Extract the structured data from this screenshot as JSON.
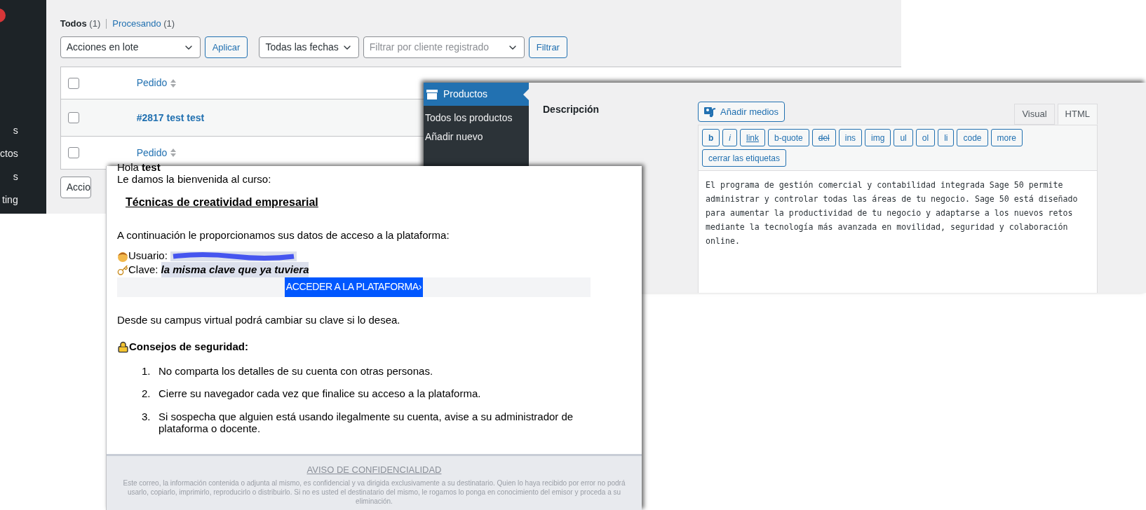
{
  "orders_screen": {
    "sidebar_fragments": [
      "s",
      "ctos",
      "s",
      "ting"
    ],
    "views": [
      {
        "label": "Todos",
        "count": "(1)",
        "selected": true
      },
      {
        "label": "Procesando",
        "count": "(1)",
        "selected": false
      }
    ],
    "bulk_action": "Acciones en lote",
    "apply": "Aplicar",
    "date_filter": "Todas las fechas",
    "customer_filter": {
      "placeholder": "Filtrar por cliente registrado"
    },
    "filter": "Filtrar",
    "columns": [
      "Pedido"
    ],
    "header_checked": false,
    "rows": [
      {
        "order": "#2817 test test",
        "checked": false
      }
    ],
    "footer_column": "Pedido",
    "footer_checked": false,
    "bottom_bulk_action": "Accio"
  },
  "product_screen": {
    "menu": {
      "title": "Productos",
      "items": [
        "Todos los productos",
        "Añadir nuevo"
      ]
    },
    "field_label": "Descripción",
    "add_media": "Añadir medios",
    "editor_tabs": [
      {
        "label": "Visual",
        "selected": false
      },
      {
        "label": "HTML",
        "selected": true
      }
    ],
    "toolbar": [
      {
        "label": "b",
        "kind": "bold"
      },
      {
        "label": "i",
        "kind": "italic"
      },
      {
        "label": "link",
        "kind": "underline"
      },
      {
        "label": "b-quote",
        "kind": "plain"
      },
      {
        "label": "del",
        "kind": "strike"
      },
      {
        "label": "ins",
        "kind": "plain"
      },
      {
        "label": "img",
        "kind": "plain"
      },
      {
        "label": "ul",
        "kind": "plain"
      },
      {
        "label": "ol",
        "kind": "plain"
      },
      {
        "label": "li",
        "kind": "plain"
      },
      {
        "label": "code",
        "kind": "plain"
      },
      {
        "label": "more",
        "kind": "plain"
      },
      {
        "label": "cerrar las etiquetas",
        "kind": "plain"
      }
    ],
    "content": "El programa de gestión comercial y contabilidad integrada Sage 50 permite administrar y controlar todas las áreas de tu negocio. Sage 50 está diseñado para aumentar la productividad de tu negocio y adaptarse a los nuevos retos mediante la tecnología más avanzada en movilidad, seguridad y colaboración online."
  },
  "email": {
    "greeting": "Hola **test**",
    "welcome": "Le damos la bienvenida al curso:",
    "course": "Técnicas de creatividad empresarial",
    "intro": "A continuación le proporcionamos sus datos de acceso a la plataforma:",
    "user_label": "Usuario:",
    "password_label": "Clave:",
    "password_value": "la misma clave que ya tuviera",
    "access_button": "ACCEDER A LA PLATAFORMA›",
    "campus_note": "Desde su campus virtual podrá cambiar su clave si lo desea.",
    "security_title": "Consejos de seguridad:",
    "tips": [
      {
        "number": "1.",
        "text": "No comparta los detalles de su cuenta con otras personas."
      },
      {
        "number": "2.",
        "text": "Cierre su navegador cada vez que finalice su acceso a la plataforma."
      },
      {
        "number": "3.",
        "text": "Si sospecha que alguien está usando ilegalmente su cuenta, avise a su administrador de plataforma o docente."
      }
    ],
    "notice_title": "AVISO DE CONFIDENCIALIDAD",
    "notice_text": "Este correo, la información contenida o adjunta al mismo, es confidencial y va dirigida exclusivamente a su destinatario. Quien lo haya recibido por error no podrá usarlo, copiarlo, imprimirlo, reproducirlo o distribuirlo. Si no es usted el destinatario del mismo, le rogamos lo ponga en conocimiento del emisor y proceda a su eliminación."
  }
}
